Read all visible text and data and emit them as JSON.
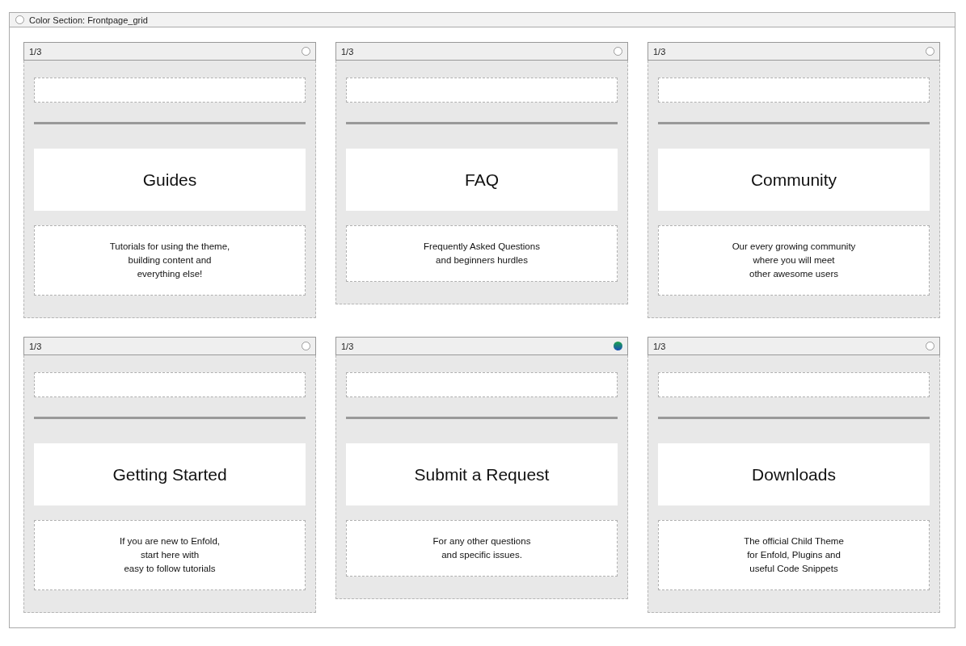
{
  "section": {
    "title": "Color Section: Frontpage_grid"
  },
  "cards": [
    {
      "size": "1/3",
      "color_set": false,
      "heading": "Guides",
      "description_lines": [
        "Tutorials for using the theme,",
        "building content and",
        "everything else!"
      ]
    },
    {
      "size": "1/3",
      "color_set": false,
      "heading": "FAQ",
      "description_lines": [
        "Frequently Asked Questions",
        "and beginners hurdles"
      ]
    },
    {
      "size": "1/3",
      "color_set": false,
      "heading": "Community",
      "description_lines": [
        "Our every growing community",
        "where you will meet",
        "other awesome users"
      ]
    },
    {
      "size": "1/3",
      "color_set": false,
      "heading": "Getting Started",
      "description_lines": [
        "If you are new to Enfold,",
        "start here with",
        "easy to follow tutorials"
      ]
    },
    {
      "size": "1/3",
      "color_set": true,
      "heading": "Submit a Request",
      "description_lines": [
        "For any other questions",
        "and specific issues."
      ]
    },
    {
      "size": "1/3",
      "color_set": false,
      "heading": "Downloads",
      "description_lines": [
        "The official Child Theme",
        "for Enfold, Plugins and",
        "useful Code Snippets"
      ]
    }
  ]
}
